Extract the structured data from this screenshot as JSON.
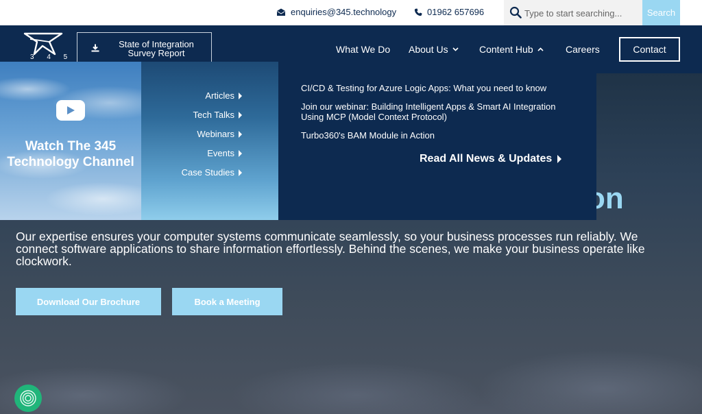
{
  "topbar": {
    "email": "enquiries@345.technology",
    "phone": "01962 657696",
    "search_placeholder": "Type to start searching...",
    "search_button": "Search",
    "icons": [
      "envelope-icon",
      "phone-icon",
      "search-icon"
    ]
  },
  "header": {
    "logo_number": "3 4 5",
    "survey_button": "State of Integration Survey Report",
    "nav": [
      {
        "label": "What We Do"
      },
      {
        "label": "About Us",
        "icon": "chevron-down-icon"
      },
      {
        "label": "Content Hub",
        "icon": "chevron-up-icon"
      },
      {
        "label": "Careers"
      }
    ],
    "contact_button": "Contact"
  },
  "mega_menu": {
    "video_title": "Watch The 345 Technology Channel",
    "categories": [
      "Articles",
      "Tech Talks",
      "Webinars",
      "Events",
      "Case Studies"
    ],
    "news": [
      "CI/CD & Testing for Azure Logic Apps: What you need to know",
      "Join our webinar: Building Intelligent Apps & Smart AI Integration Using MCP (Model Context Protocol)",
      "Turbo360's BAM Module in Action"
    ],
    "read_all": "Read All News & Updates"
  },
  "hero": {
    "heading_fragment": "on",
    "paragraph": "Our expertise ensures your computer systems communicate seamlessly, so your business processes run reliably. We connect software applications to share information effortlessly. Behind the scenes, we make your business operate like clockwork.",
    "button_brochure": "Download Our Brochure",
    "button_meeting": "Book a Meeting"
  },
  "colors": {
    "navy": "#0d2a50",
    "accent": "#9ad7f2",
    "cookie_green": "#20b57a"
  }
}
